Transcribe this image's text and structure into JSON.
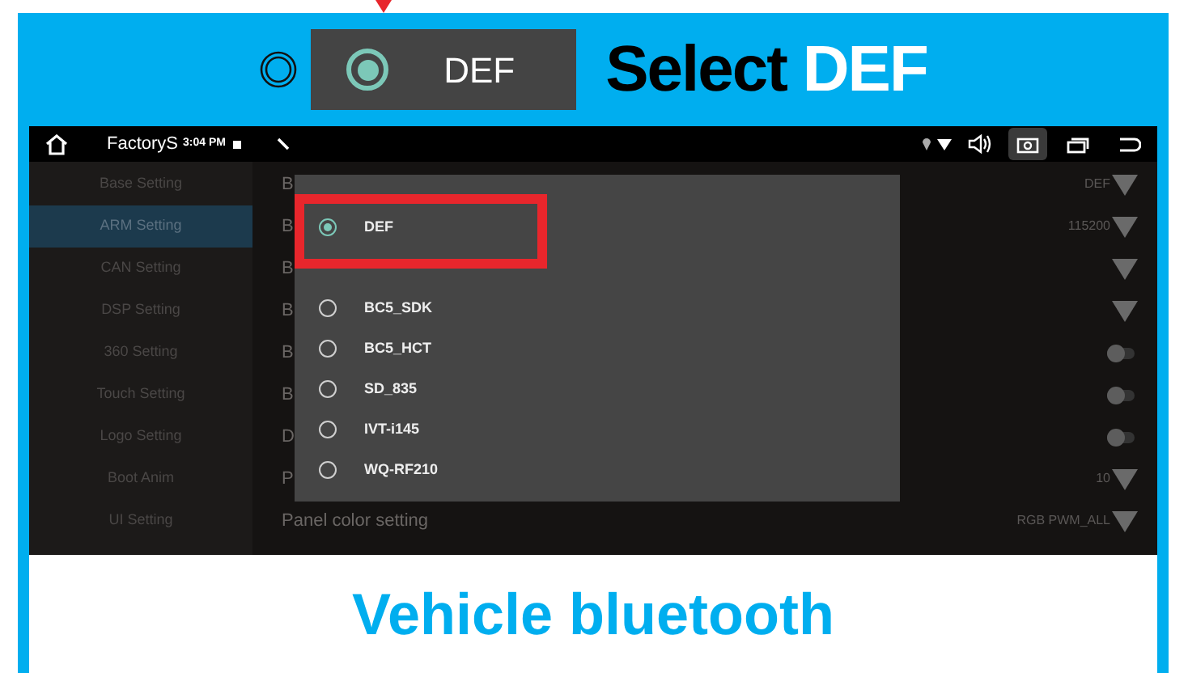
{
  "header": {
    "option": {
      "selected": true,
      "label": "DEF"
    },
    "title": "Select",
    "title_highlight": "DEF"
  },
  "status_bar": {
    "app_title": "FactoryS",
    "time": "3:04 PM"
  },
  "sidebar": {
    "items": [
      {
        "label": "Base Setting",
        "selected": false
      },
      {
        "label": "ARM Setting",
        "selected": true
      },
      {
        "label": "CAN Setting",
        "selected": false
      },
      {
        "label": "DSP Setting",
        "selected": false
      },
      {
        "label": "360 Setting",
        "selected": false
      },
      {
        "label": "Touch Setting",
        "selected": false
      },
      {
        "label": "Logo Setting",
        "selected": false
      },
      {
        "label": "Boot Anim",
        "selected": false
      },
      {
        "label": "UI Setting",
        "selected": false
      }
    ]
  },
  "settings": {
    "rows": [
      {
        "label": "B",
        "kind": "dropdown",
        "value": "DEF"
      },
      {
        "label": "B",
        "kind": "dropdown",
        "value": "115200"
      },
      {
        "label": "B",
        "kind": "dropdown"
      },
      {
        "label": "B",
        "kind": "dropdown"
      },
      {
        "label": "B",
        "kind": "toggle",
        "on": false
      },
      {
        "label": "B",
        "kind": "toggle",
        "on": false
      },
      {
        "label": "D",
        "kind": "toggle",
        "on": false
      },
      {
        "label": "P",
        "kind": "dropdown",
        "value": "10"
      },
      {
        "label": "Panel color setting",
        "kind": "dropdown",
        "value": "RGB PWM_ALL"
      }
    ]
  },
  "dialog": {
    "options": [
      {
        "label": "DEF",
        "selected": true
      },
      {
        "label": "BC5_SDK",
        "selected": false
      },
      {
        "label": "BC5_HCT",
        "selected": false
      },
      {
        "label": "SD_835",
        "selected": false
      },
      {
        "label": "IVT-i145",
        "selected": false
      },
      {
        "label": "WQ-RF210",
        "selected": false
      }
    ]
  },
  "caption": "Vehicle bluetooth"
}
